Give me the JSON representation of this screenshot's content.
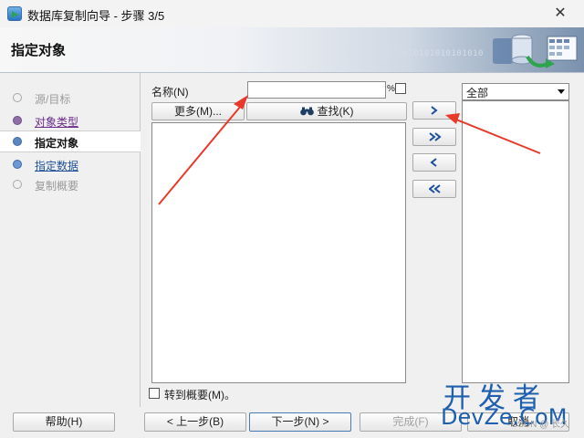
{
  "window": {
    "title": "数据库复制向导 - 步骤 3/5",
    "close_glyph": "✕"
  },
  "header": {
    "title": "指定对象",
    "binary_text": "0101010101010101010101010\n          010101010"
  },
  "nav": {
    "steps": [
      {
        "label": "源/目标",
        "state": "done"
      },
      {
        "label": "对象类型",
        "state": "visited"
      },
      {
        "label": "指定对象",
        "state": "current"
      },
      {
        "label": "指定数据",
        "state": "next"
      },
      {
        "label": "复制概要",
        "state": "future"
      }
    ]
  },
  "search": {
    "name_label": "名称(N)",
    "name_value": "",
    "percent_sign": "%",
    "more_label": "更多(M)...",
    "find_label": "查找(K)"
  },
  "schema_select": {
    "value": "全部"
  },
  "move_buttons": {
    "right": "move-one-right",
    "all_right": "move-all-right",
    "left": "move-one-left",
    "all_left": "move-all-left"
  },
  "goto_summary": {
    "label": "转到概要(M)。",
    "checked": false
  },
  "footer": {
    "help": "帮助(H)",
    "back": "< 上一步(B)",
    "next": "下一步(N) >",
    "finish": "完成(F)",
    "cancel": "取消"
  },
  "watermark": {
    "line1": "开发者",
    "line2": "DevZe.CoM",
    "line3": "CSDN @ 长久"
  },
  "colors": {
    "annotation_arrow": "#e8392a",
    "accent_blue": "#1e5fae"
  }
}
